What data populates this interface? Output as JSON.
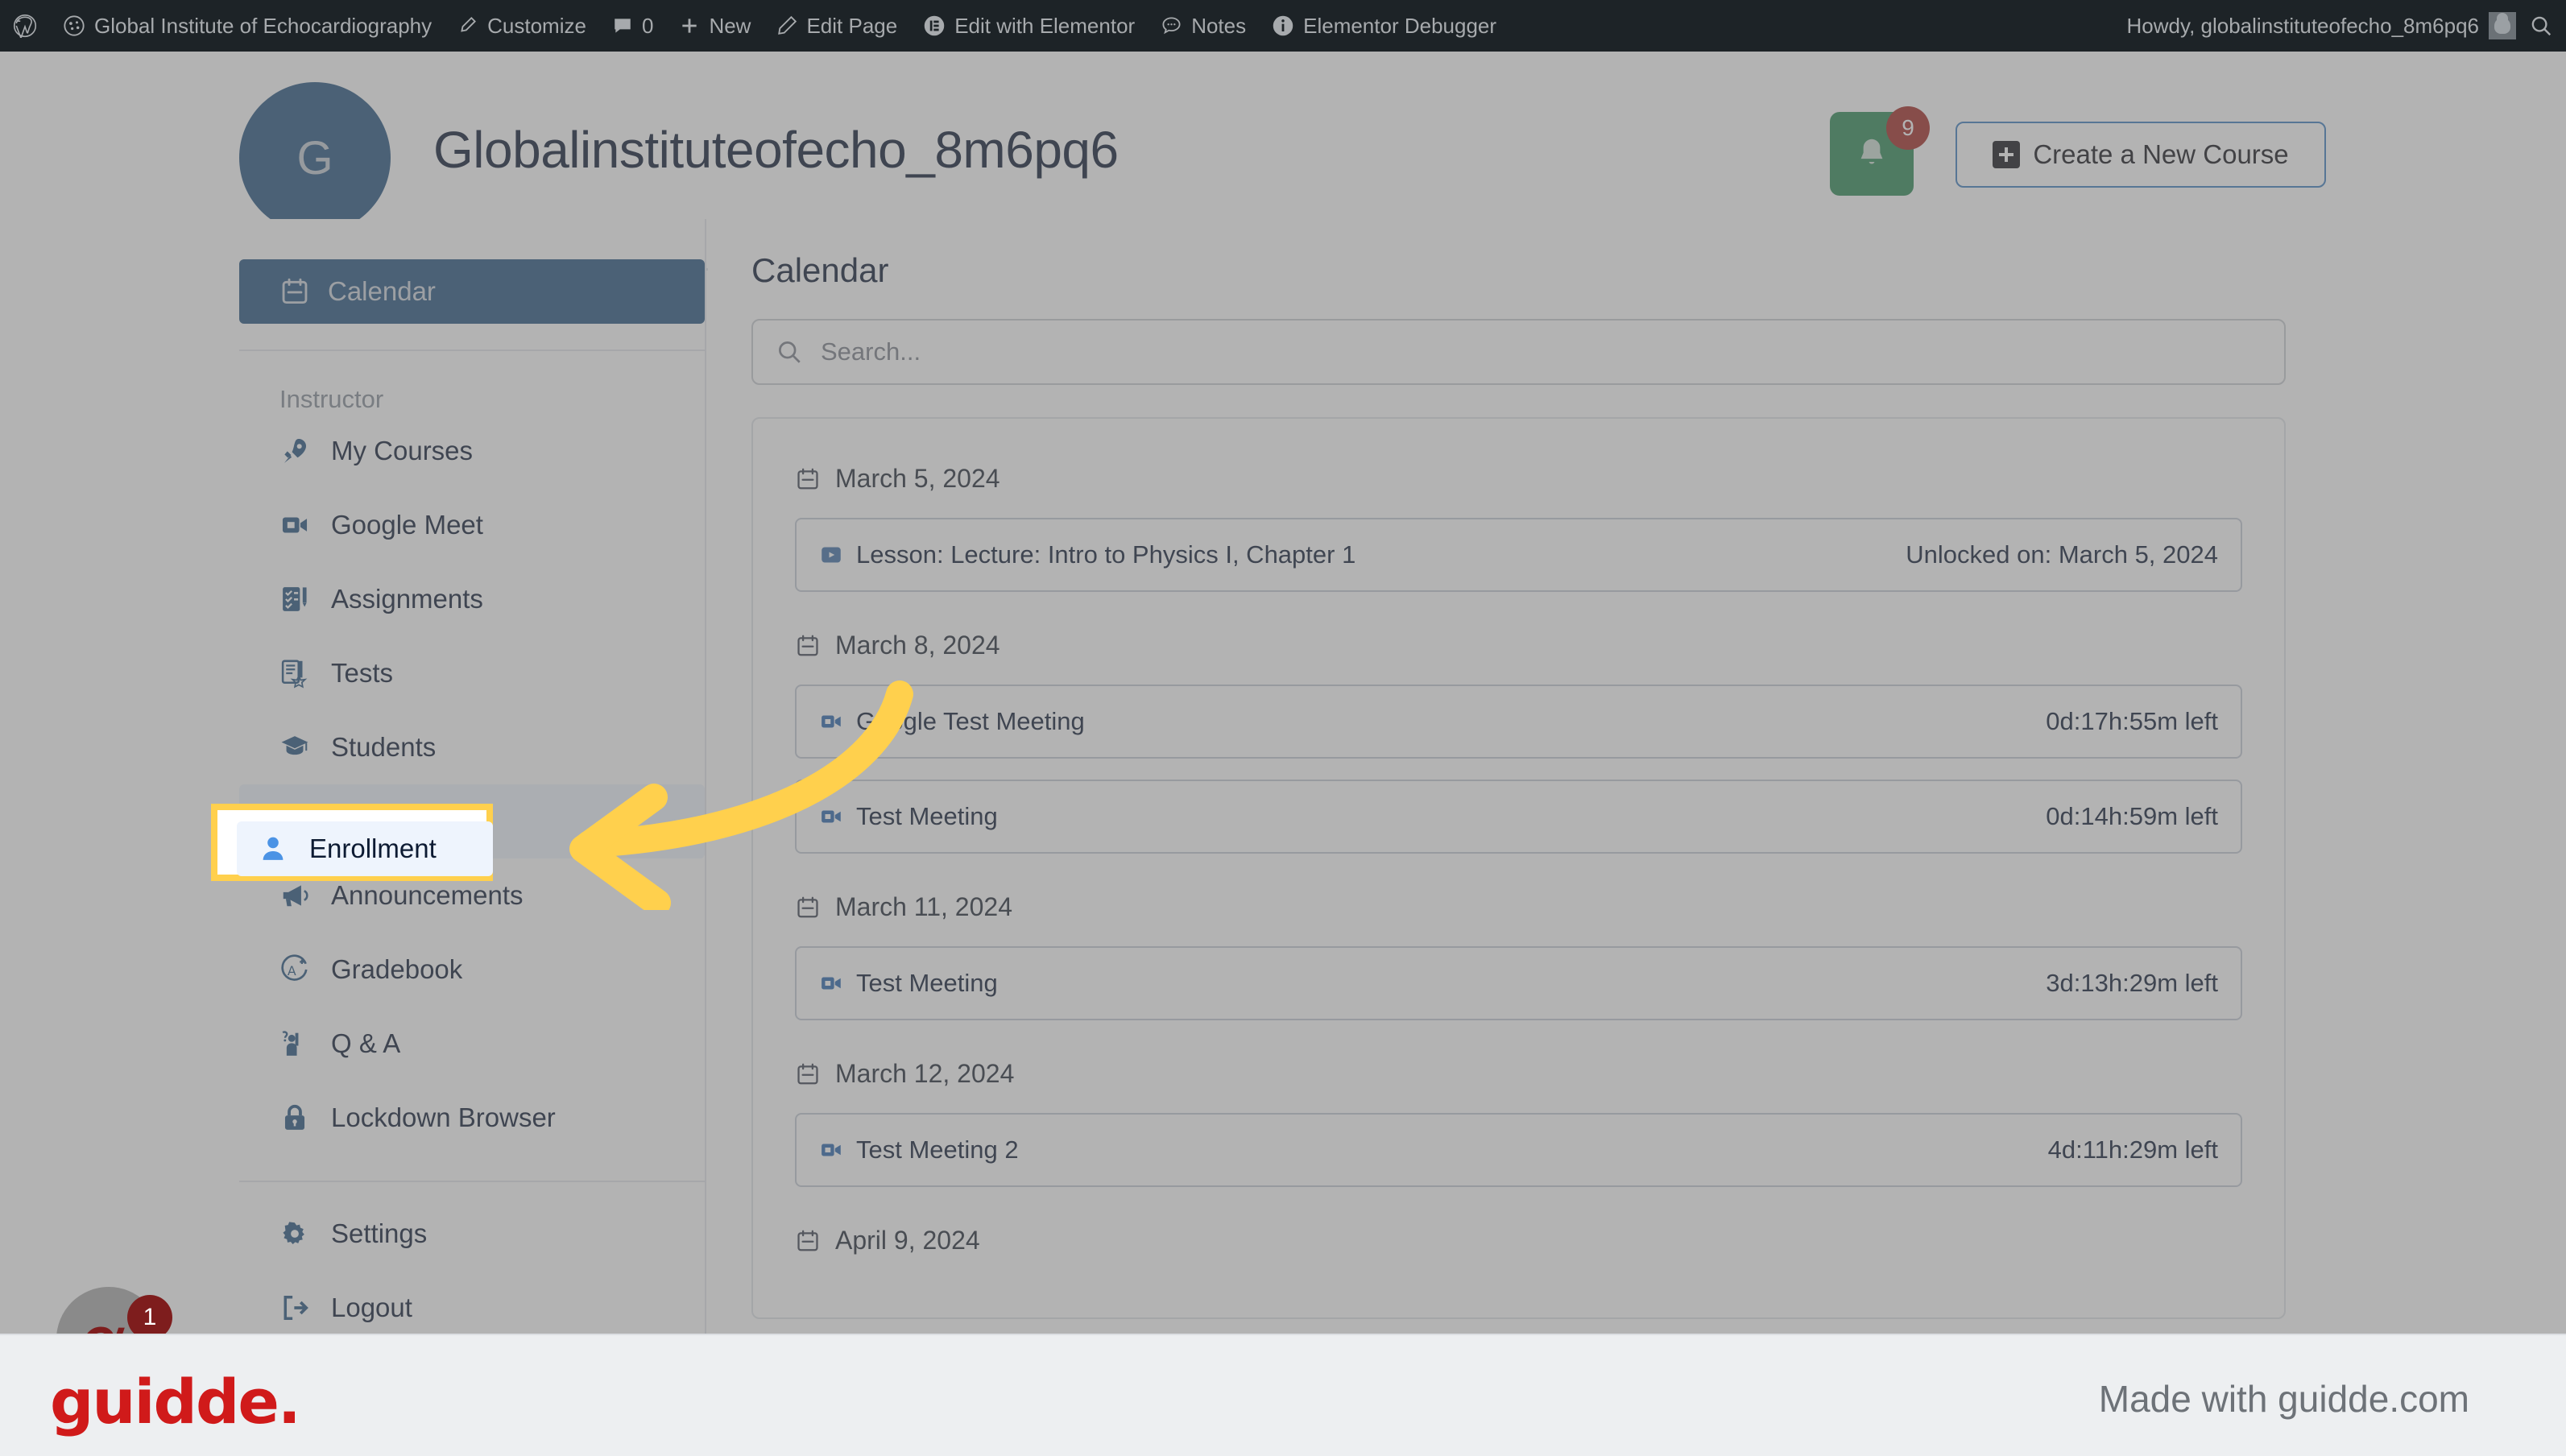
{
  "admin_bar": {
    "items": [
      {
        "icon": "wordpress-icon",
        "label": ""
      },
      {
        "icon": "site-icon",
        "label": "Global Institute of Echocardiography"
      },
      {
        "icon": "customize-icon",
        "label": "Customize"
      },
      {
        "icon": "comment-icon",
        "label": "0"
      },
      {
        "icon": "plus-icon",
        "label": "New"
      },
      {
        "icon": "pencil-icon",
        "label": "Edit Page"
      },
      {
        "icon": "elementor-icon",
        "label": "Edit with Elementor"
      },
      {
        "icon": "notes-icon",
        "label": "Notes"
      },
      {
        "icon": "info-icon",
        "label": "Elementor Debugger"
      }
    ],
    "howdy": "Howdy, globalinstituteofecho_8m6pq6",
    "avatar_icon": "user-avatar-icon",
    "search_icon": "search-icon"
  },
  "header": {
    "avatar_initial": "G",
    "title": "Globalinstituteofecho_8m6pq6",
    "bell_icon": "bell-icon",
    "bell_badge": "9",
    "create_button": "Create a New Course",
    "create_icon": "plus-square-icon",
    "colors": {
      "avatar_bg": "#27557f",
      "bell_bg": "#2e8b57",
      "badge_bg": "#a32a25",
      "create_border": "#3f7fc1"
    }
  },
  "sidebar": {
    "active_item": {
      "label": "Calendar",
      "icon": "calendar-icon"
    },
    "group_label": "Instructor",
    "items": [
      {
        "label": "My Courses",
        "icon": "rocket-icon"
      },
      {
        "label": "Google Meet",
        "icon": "video-camera-icon"
      },
      {
        "label": "Assignments",
        "icon": "checklist-icon"
      },
      {
        "label": "Tests",
        "icon": "document-star-icon"
      },
      {
        "label": "Students",
        "icon": "graduation-cap-icon"
      },
      {
        "label": "Enrollment",
        "icon": "person-icon",
        "highlighted": true
      },
      {
        "label": "Announcements",
        "icon": "megaphone-icon"
      },
      {
        "label": "Gradebook",
        "icon": "grade-a-plus-icon"
      },
      {
        "label": "Q & A",
        "icon": "question-person-icon"
      },
      {
        "label": "Lockdown Browser",
        "icon": "lock-icon"
      }
    ],
    "footer_items": [
      {
        "label": "Settings",
        "icon": "gear-icon"
      },
      {
        "label": "Logout",
        "icon": "logout-icon"
      }
    ]
  },
  "content": {
    "title": "Calendar",
    "search": {
      "placeholder": "Search...",
      "value": "",
      "icon": "search-icon"
    },
    "groups": [
      {
        "date": "March 5, 2024",
        "date_icon": "calendar-icon",
        "events": [
          {
            "icon": "play-video-icon",
            "title": "Lesson:  Lecture: Intro to Physics I, Chapter 1",
            "meta": "Unlocked on: March 5, 2024"
          }
        ]
      },
      {
        "date": "March 8, 2024",
        "date_icon": "calendar-icon",
        "events": [
          {
            "icon": "video-camera-icon",
            "title": "Google Test Meeting",
            "meta": "0d:17h:55m left"
          },
          {
            "icon": "video-camera-icon",
            "title": "Test Meeting",
            "meta": "0d:14h:59m left"
          }
        ]
      },
      {
        "date": "March 11, 2024",
        "date_icon": "calendar-icon",
        "events": [
          {
            "icon": "video-camera-icon",
            "title": "Test Meeting",
            "meta": "3d:13h:29m left"
          }
        ]
      },
      {
        "date": "March 12, 2024",
        "date_icon": "calendar-icon",
        "events": [
          {
            "icon": "video-camera-icon",
            "title": "Test Meeting 2",
            "meta": "4d:11h:29m left"
          }
        ]
      },
      {
        "date": "April 9, 2024",
        "date_icon": "calendar-icon",
        "events": []
      }
    ]
  },
  "annotation": {
    "highlight_target": "Enrollment",
    "highlight_icon": "person-icon",
    "highlight_color": "#ffd04d",
    "arrow_color": "#ffd04d",
    "arrow_icon": "curved-arrow-left-icon"
  },
  "chat_widget": {
    "badge": "1",
    "icon": "chat-bubble-icon"
  },
  "footer": {
    "logo": "guidde.",
    "tagline": "Made with guidde.com",
    "logo_color": "#d01a1a"
  }
}
